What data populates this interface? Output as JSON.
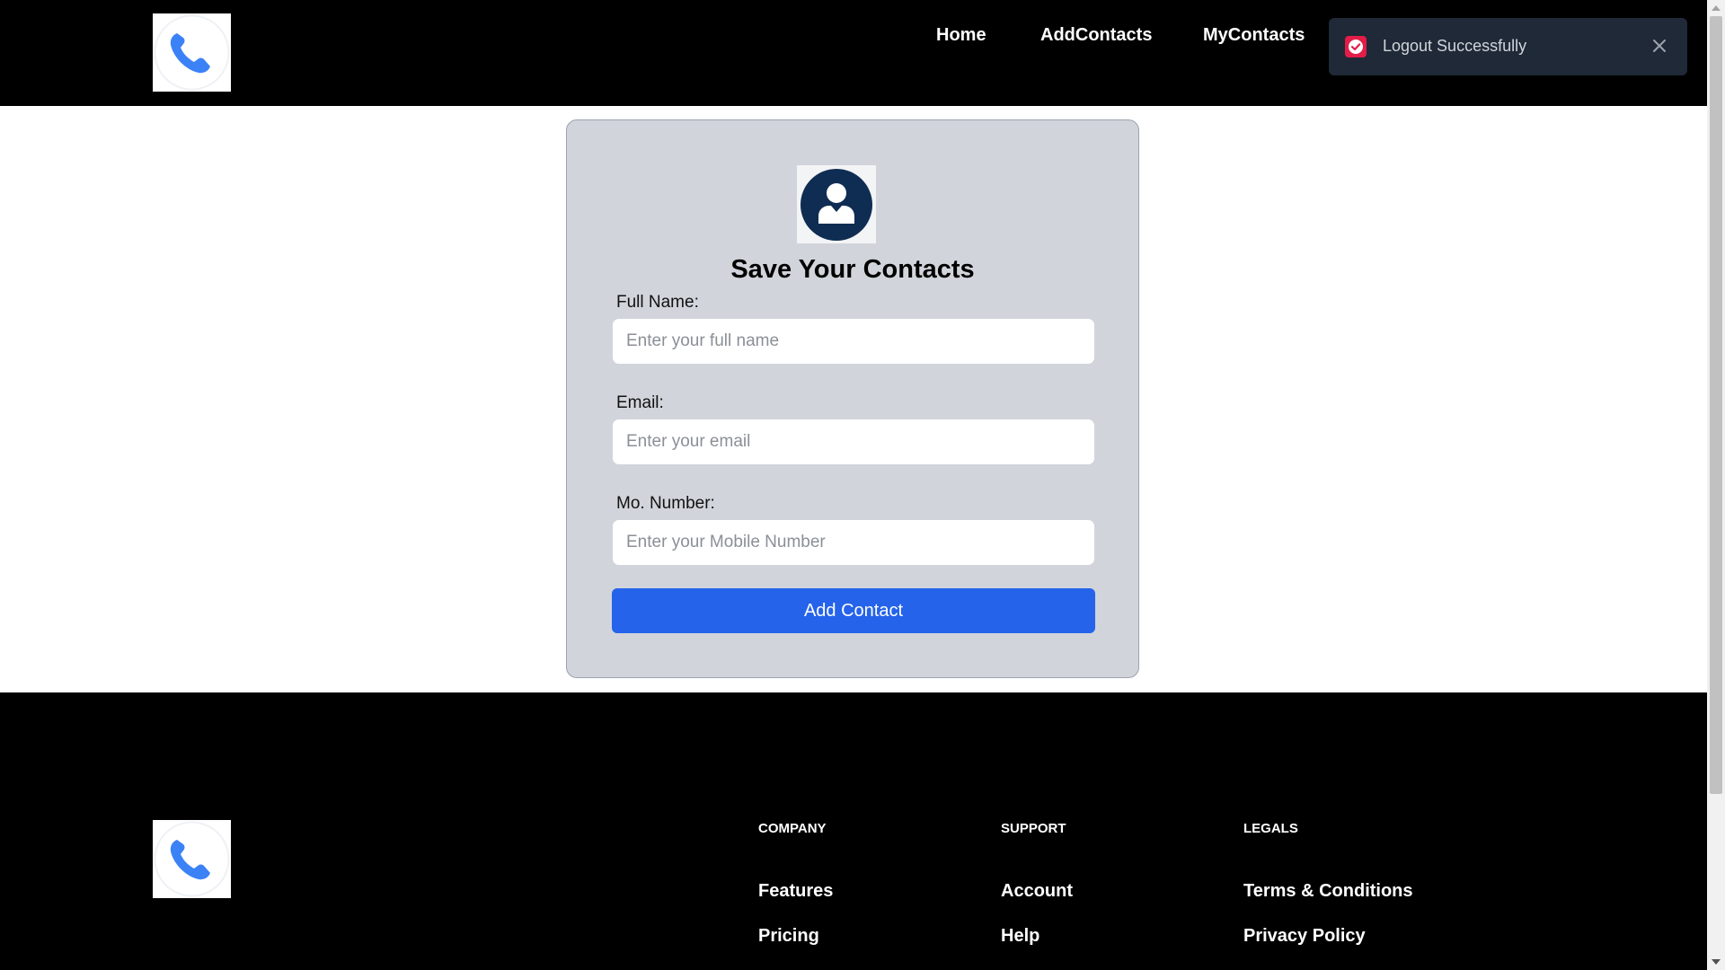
{
  "header": {
    "logo": "phone-icon",
    "nav": [
      {
        "label": "Home"
      },
      {
        "label": "AddContacts"
      },
      {
        "label": "MyContacts"
      }
    ]
  },
  "toast": {
    "message": "Logout Successfully",
    "icon": "check-icon",
    "close_icon": "close-icon"
  },
  "form": {
    "avatar_icon": "user-icon",
    "title": "Save Your Contacts",
    "fields": [
      {
        "label": "Full Name:",
        "placeholder": "Enter your full name",
        "value": ""
      },
      {
        "label": "Email:",
        "placeholder": "Enter your email",
        "value": ""
      },
      {
        "label": "Mo. Number:",
        "placeholder": "Enter your Mobile Number",
        "value": ""
      }
    ],
    "submit_label": "Add Contact"
  },
  "footer": {
    "logo": "phone-icon",
    "columns": [
      {
        "heading": "COMPANY",
        "links": [
          "Features",
          "Pricing"
        ]
      },
      {
        "heading": "SUPPORT",
        "links": [
          "Account",
          "Help"
        ]
      },
      {
        "heading": "LEGALS",
        "links": [
          "Terms & Conditions",
          "Privacy Policy"
        ]
      }
    ]
  },
  "colors": {
    "header_bg": "#000000",
    "toast_bg": "#1f2937",
    "card_bg": "#d1d5db",
    "button_bg": "#2563eb",
    "avatar_bg": "#0f2d52",
    "phone_blue": "#3b82f6",
    "toast_icon_red": "#e11d48"
  }
}
